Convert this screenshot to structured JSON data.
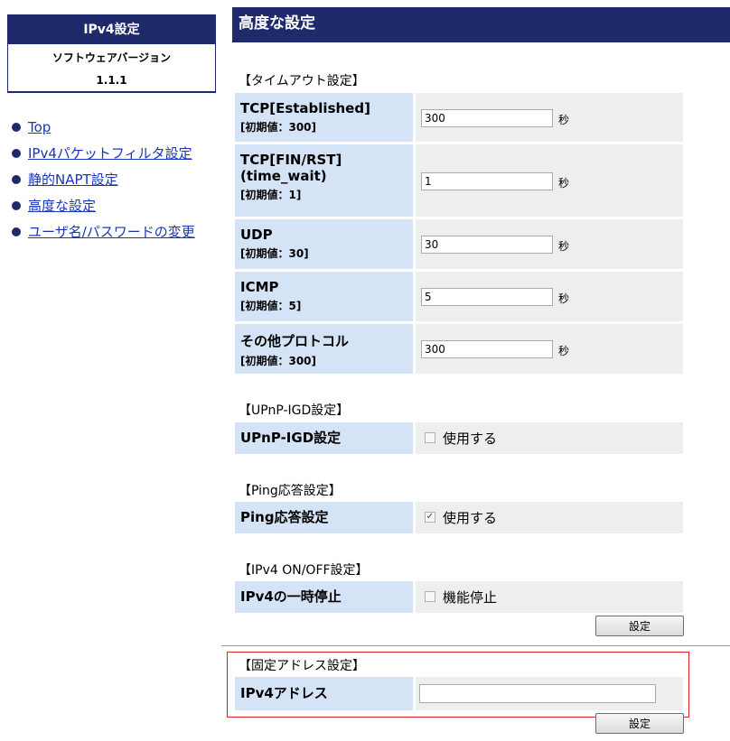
{
  "sidebar": {
    "title": "IPv4設定",
    "software_label": "ソフトウェアバージョン",
    "version": "1.1.1",
    "nav": [
      "Top",
      "IPv4パケットフィルタ設定",
      "静的NAPT設定",
      "高度な設定",
      "ユーザ名/パスワードの変更"
    ]
  },
  "header": {
    "title": "高度な設定"
  },
  "timeout": {
    "section": "【タイムアウト設定】",
    "unit": "秒",
    "rows": [
      {
        "name": "TCP[Established]",
        "name2": "",
        "init": "[初期値：300]",
        "value": "300"
      },
      {
        "name": "TCP[FIN/RST]",
        "name2": "(time_wait)",
        "init": "[初期値：1]",
        "value": "1"
      },
      {
        "name": "UDP",
        "name2": "",
        "init": "[初期値：30]",
        "value": "30"
      },
      {
        "name": "ICMP",
        "name2": "",
        "init": "[初期値：5]",
        "value": "5"
      },
      {
        "name": "その他プロトコル",
        "name2": "",
        "init": "[初期値：300]",
        "value": "300"
      }
    ]
  },
  "upnp": {
    "section": "【UPnP-IGD設定】",
    "label": "UPnP-IGD設定",
    "checkbox_label": "使用する",
    "checked": false
  },
  "ping": {
    "section": "【Ping応答設定】",
    "label": "Ping応答設定",
    "checkbox_label": "使用する",
    "checked": true
  },
  "ipv4onoff": {
    "section": "【IPv4 ON/OFF設定】",
    "label": "IPv4の一時停止",
    "checkbox_label": "機能停止",
    "checked": false
  },
  "set_button": "設定",
  "fixed_addr": {
    "section": "【固定アドレス設定】",
    "label": "IPv4アドレス",
    "value": "",
    "button": "設定"
  }
}
